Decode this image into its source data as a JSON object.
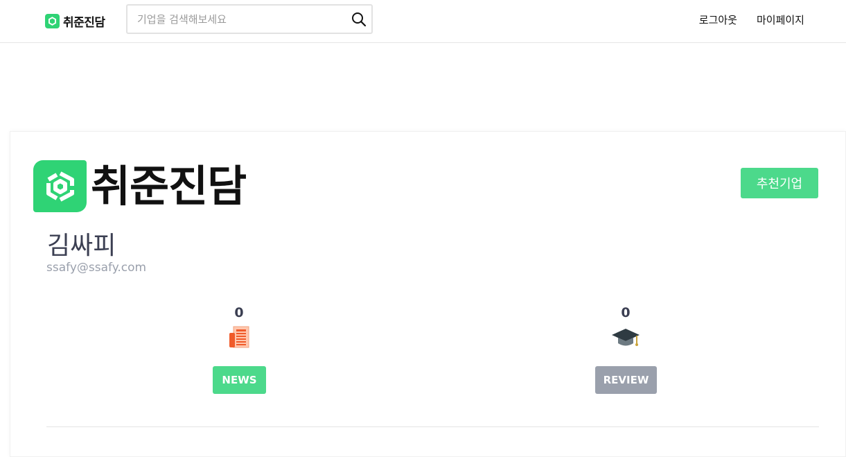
{
  "header": {
    "brand_name": "취준진담",
    "search_placeholder": "기업을 검색해보세요",
    "nav": {
      "logout": "로그아웃",
      "mypage": "마이페이지"
    }
  },
  "profile": {
    "logo_text": "취준진담",
    "recommend_label": "추천기업",
    "name": "김싸피",
    "email": "ssafy@ssafy.com",
    "news": {
      "count": "0",
      "label": "NEWS",
      "icon": "newspaper-icon"
    },
    "review": {
      "count": "0",
      "label": "REVIEW",
      "icon": "graduation-cap-icon"
    }
  },
  "colors": {
    "brand": "#2fd375",
    "button_green": "#4cd98b",
    "button_gray": "#9aa0ac"
  }
}
